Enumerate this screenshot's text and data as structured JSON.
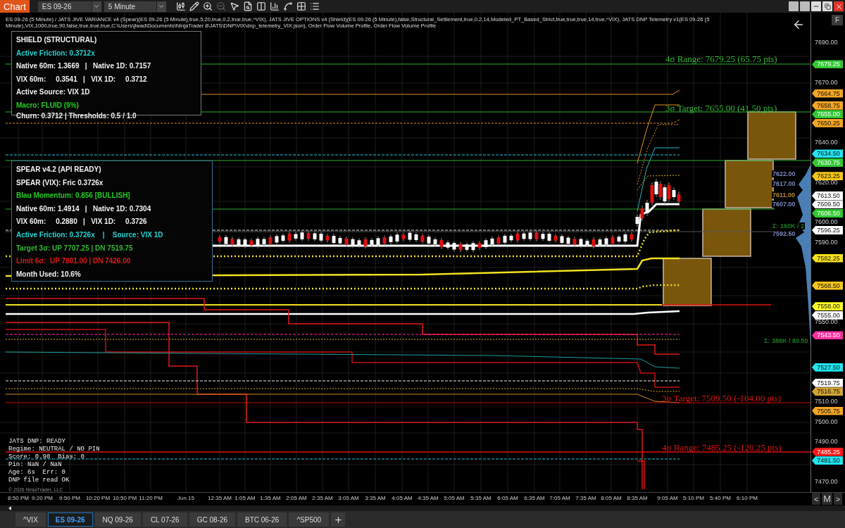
{
  "title_bar": {
    "app_label": "Chart",
    "instrument": "ES 09-26",
    "interval": "5 Minute"
  },
  "toolbar": [
    {
      "disabled": false
    },
    {
      "disabled": false
    },
    {
      "disabled": false
    },
    {
      "disabled": true
    },
    {
      "disabled": false
    },
    {
      "disabled": false
    },
    {
      "disabled": false
    },
    {
      "disabled": false
    },
    {
      "disabled": false
    },
    {
      "disabled": false
    },
    {
      "disabled": false
    }
  ],
  "chart_header": "ES 09-26 (5 Minute) / JATS JIVE VARIANCE v4 (Spear)(ES 09-26 (5 Minute),true,5,20,true,0.2,true,true,^VIX), JATS JIVE OPTIONS v4 (Shield)(ES 09-26 (5 Minute),false,Structural_Settlement,true,0.2,14,Modeled_PT_Based_Strict,true,true,true,14,true,^VIX), JATS DNP Telemetry v1(ES 09-26 (5 Minute),VIX,1000,true,90,false,true,true,true,C:\\Users\\jlwad\\Documents\\NinjaTrader 8\\JATS\\DNP\\VIX\\dnp_telemetry_VIX.json), Order Flow Volume Profile, Order Flow Volume Profile",
  "shield_panel": {
    "title": "SHIELD (STRUCTURAL)",
    "lines": [
      {
        "text": "Active Friction: 0.3712x",
        "color": "#22d3d3"
      },
      {
        "text": "Native 60m: 1.3669   |   Native 1D: 0.7157",
        "color": "#f2f2f2"
      },
      {
        "text": "VIX 60m:     0.3541   |   VIX 1D:     0.3712",
        "color": "#f2f2f2"
      },
      {
        "text": "Active Source: VIX 1D",
        "color": "#f2f2f2"
      },
      {
        "text": "Macro: FLUID (9%)",
        "color": "#22cc22"
      }
    ],
    "footer": "Churn: 0.3712 | Thresholds: 0.5 / 1.0"
  },
  "spear_panel": {
    "title": "SPEAR v4.2 (API READY)",
    "lines": [
      {
        "text": "SPEAR (VIX): Fric 0.3726x",
        "color": "#f2f2f2"
      },
      {
        "text": "Blau Momentum: 0.856 [BULLISH]",
        "color": "#22cc22"
      },
      {
        "text": "Native 60m: 1.4914   |   Native 1D: 0.7304",
        "color": "#f2f2f2"
      },
      {
        "text": "VIX 60m:     0.2880   |   VIX 1D:     0.3726",
        "color": "#f2f2f2"
      },
      {
        "text": "Active Friction: 0.3726x    |    Source: VIX 1D",
        "color": "#22d3d3"
      },
      {
        "text": "Target 3σ: UP 7707.25 | DN 7519.75",
        "color": "#33b833"
      },
      {
        "text": "Limit 6σ:  UP 7801.00 | DN 7426.00",
        "color": "#e01818"
      },
      {
        "text": "Month Used: 10.6%",
        "color": "#f2f2f2"
      }
    ]
  },
  "sigma_labels": [
    {
      "text": "4σ Range: 7679.25 (65.75 pts)",
      "color": "#33b833"
    },
    {
      "text": "3σ Target: 7655.00 (41.50 pts)",
      "color": "#33b833"
    },
    {
      "text": "3σ Target: 7509.50 (-104.00 pts)",
      "color": "#e01010"
    },
    {
      "text": "4σ Range: 7485.25 (-120.25 pts)",
      "color": "#e01010"
    }
  ],
  "volume_labels": [
    {
      "text": "7622.00",
      "color": "#7c88c0"
    },
    {
      "text": "7617.00",
      "color": "#7c88c0"
    },
    {
      "text": "7611.00",
      "color": "#b08a2a"
    },
    {
      "text": "7607.00",
      "color": "#7c88c0"
    },
    {
      "text": "Σ: 160K / 2",
      "color": "#1f7a1f"
    },
    {
      "text": "7592.50",
      "color": "#7c88c0"
    },
    {
      "text": "Σ: 386K / 80.50",
      "color": "#1f7a1f"
    }
  ],
  "dnp_telemetry": [
    "JATS DNP: READY",
    "Regime: NEUTRAL / NO PIN",
    "Score: 0.90  Bias: 0",
    "Pin: NaN / NaN",
    "Age: 6s  Err: 0",
    "DNP file read OK"
  ],
  "copyright": "© 2026 NinjaTrader, LLC",
  "price_axis": {
    "ticks": [
      "7690.00",
      "7670.00",
      "7640.00",
      "7620.00",
      "7600.00",
      "7590.00",
      "7550.00",
      "7510.00",
      "7500.00",
      "7490.00",
      "7470.00"
    ],
    "markers": [
      {
        "price": "7679.25",
        "color": "#33c833"
      },
      {
        "price": "7664.75",
        "color": "#f5a623"
      },
      {
        "price": "7658.75",
        "color": "#f5a623"
      },
      {
        "price": "7655.00",
        "color": "#33c833"
      },
      {
        "price": "7650.25",
        "color": "#f5a623"
      },
      {
        "price": "7634.50",
        "color": "#22e5f0"
      },
      {
        "price": "7630.75",
        "color": "#33c833"
      },
      {
        "price": "7623.25",
        "color": "#f5c518"
      },
      {
        "price": "7613.50",
        "color": "#ffffff"
      },
      {
        "price": "7609.50",
        "color": "#ffffff"
      },
      {
        "price": "7606.50",
        "color": "#33c833"
      },
      {
        "price": "7596.25",
        "color": "#ffffff"
      },
      {
        "price": "7582.25",
        "color": "#f5e01a"
      },
      {
        "price": "7568.50",
        "color": "#f5c518"
      },
      {
        "price": "7558.00",
        "color": "#ffff22"
      },
      {
        "price": "7555.00",
        "color": "#ffffff"
      },
      {
        "price": "7543.50",
        "color": "#ff2fa0"
      },
      {
        "price": "7527.50",
        "color": "#22e5f0"
      },
      {
        "price": "7519.75",
        "color": "#ffffff"
      },
      {
        "price": "7516.75",
        "color": "#d4a534"
      },
      {
        "price": "7505.75",
        "color": "#f5a623"
      },
      {
        "price": "7485.25",
        "color": "#ff1a1a"
      },
      {
        "price": "7481.50",
        "color": "#22e5f0"
      }
    ]
  },
  "side_button": "F",
  "time_axis": [
    "8:50 PM",
    "9:20 PM",
    "9:50 PM",
    "10:20 PM",
    "10:50 PM",
    "11:20 PM",
    "Jun 15",
    "12:35 AM",
    "1:05 AM",
    "1:35 AM",
    "2:05 AM",
    "2:35 AM",
    "3:05 AM",
    "3:35 AM",
    "4:05 AM",
    "4:35 AM",
    "5:05 AM",
    "5:35 AM",
    "6:05 AM",
    "6:35 AM",
    "7:05 AM",
    "7:35 AM",
    "8:05 AM",
    "8:35 AM",
    "9:05 AM",
    "5:10 PM",
    "5:40 PM",
    "6:10 PM"
  ],
  "scroll_controls": [
    "<",
    "M",
    ">"
  ],
  "tabs": [
    {
      "label": "^VIX",
      "selected": false
    },
    {
      "label": "ES 09-26",
      "selected": true
    },
    {
      "label": "NQ 09-26",
      "selected": false
    },
    {
      "label": "CL 07-26",
      "selected": false
    },
    {
      "label": "GC 08-26",
      "selected": false
    },
    {
      "label": "BTC 06-26",
      "selected": false
    },
    {
      "label": "^SP500",
      "selected": false
    }
  ]
}
